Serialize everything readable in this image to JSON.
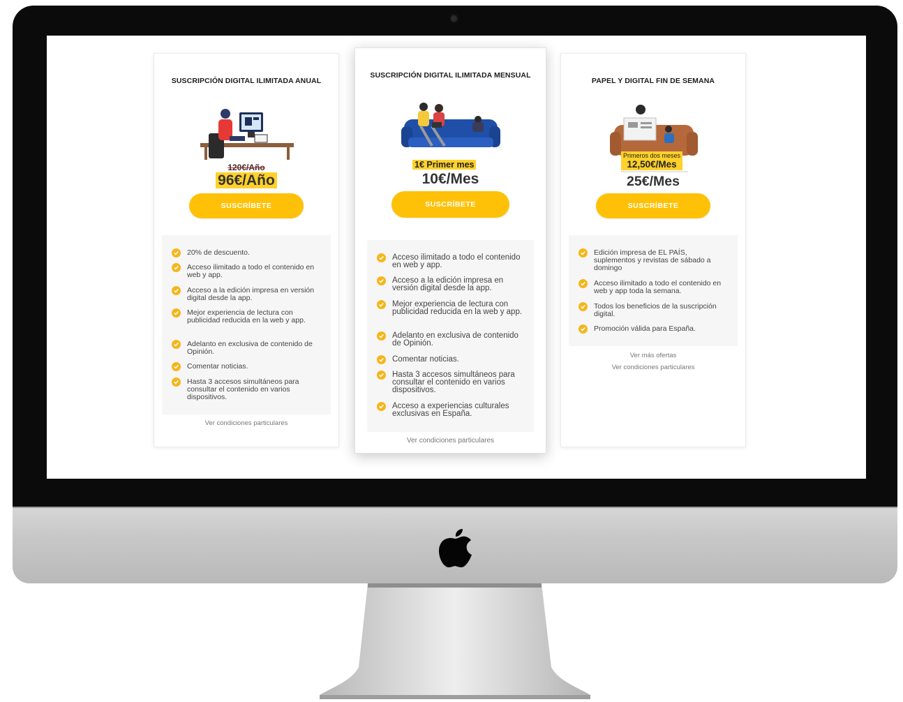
{
  "colors": {
    "accent": "#ffc107",
    "badge": "#ffd12a",
    "check": "#f6b61a",
    "feature_bg": "#f7f6f6",
    "text": "#333333"
  },
  "plans": [
    {
      "title": "SUSCRIPCIÓN DIGITAL ILIMITADA ANUAL",
      "old_price": "120€/Año",
      "price": "96€/Año",
      "button": "SUSCRÍBETE",
      "features": [
        "20% de descuento.",
        "Acceso ilimitado a todo el contenido en web y app.",
        "Acceso a la edición impresa en versión digital desde la app.",
        "Mejor experiencia de lectura con publicidad reducida en la web y app.",
        "Adelanto en exclusiva de contenido de Opinión.",
        "Comentar noticias.",
        "Hasta 3 accesos simultáneos para consultar el contenido en varios dispositivos."
      ],
      "links": [
        "Ver condiciones particulares"
      ]
    },
    {
      "title": "SUSCRIPCIÓN DIGITAL ILIMITADA MENSUAL",
      "promo": "1€ Primer mes",
      "price": "10€/Mes",
      "button": "SUSCRÍBETE",
      "features": [
        "Acceso ilimitado a todo el contenido en web y app.",
        "Acceso a la edición impresa en versión digital desde la app.",
        "Mejor experiencia de lectura con publicidad reducida en la web y app.",
        "Adelanto en exclusiva de contenido de Opinión.",
        "Comentar noticias.",
        "Hasta 3 accesos simultáneos para consultar el contenido en varios dispositivos.",
        "Acceso a experiencias culturales exclusivas en España."
      ],
      "links": [
        "Ver condiciones particulares"
      ]
    },
    {
      "title": "PAPEL Y DIGITAL FIN DE SEMANA",
      "promo_small": "Primeros dos meses",
      "promo": "12,50€/Mes",
      "price": "25€/Mes",
      "button": "SUSCRÍBETE",
      "features": [
        "Edición impresa de EL PAÍS, suplementos y revistas de sábado a domingo",
        "Acceso ilimitado a todo el contenido en web y app toda la semana.",
        "Todos los beneficios de la suscripción digital.",
        "Promoción válida para España."
      ],
      "links": [
        "Ver más ofertas",
        "Ver condiciones particulares"
      ]
    }
  ]
}
